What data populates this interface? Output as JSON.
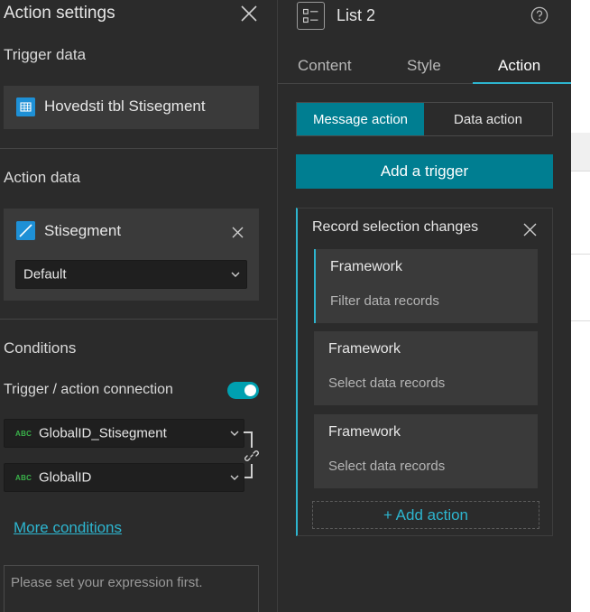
{
  "left_panel": {
    "title": "Action settings",
    "trigger_data_label": "Trigger data",
    "trigger_data_source": "Hovedsti tbl Stisegment",
    "action_data_label": "Action data",
    "action_data_source": "Stisegment",
    "action_data_view": "Default",
    "conditions_label": "Conditions",
    "connection_label": "Trigger / action connection",
    "connection_enabled": true,
    "trigger_field_type": "ABC",
    "trigger_field": "GlobalID_Stisegment",
    "action_field_type": "ABC",
    "action_field": "GlobalID",
    "more_conditions": "More conditions",
    "expression_placeholder": "Please set your expression first."
  },
  "right_panel": {
    "title": "List 2",
    "tabs": [
      {
        "label": "Content",
        "active": false
      },
      {
        "label": "Style",
        "active": false
      },
      {
        "label": "Action",
        "active": true
      }
    ],
    "segments": [
      {
        "label": "Message action",
        "active": true
      },
      {
        "label": "Data action",
        "active": false
      }
    ],
    "add_trigger": "Add a trigger",
    "trigger": {
      "title": "Record selection changes",
      "actions": [
        {
          "title": "Framework",
          "subtitle": "Filter data records",
          "selected": true
        },
        {
          "title": "Framework",
          "subtitle": "Select data records",
          "selected": false
        },
        {
          "title": "Framework",
          "subtitle": "Select data records",
          "selected": false
        }
      ],
      "add_action": "+ Add action"
    }
  },
  "colors": {
    "accent": "#2db5cf",
    "button_teal": "#007e91",
    "toggle_on": "#00a0b0",
    "panel_bg": "#2b2b2b",
    "card_bg": "#3a3a3a",
    "table_icon_bg": "#1e90d6",
    "abc_green": "#3ab24a"
  },
  "icons": {
    "close": "close-icon",
    "table": "table-icon",
    "line_layer": "line-layer-icon",
    "chevron": "chevron-down-icon",
    "link": "link-icon",
    "list_widget": "list-widget-icon",
    "help": "help-icon"
  }
}
